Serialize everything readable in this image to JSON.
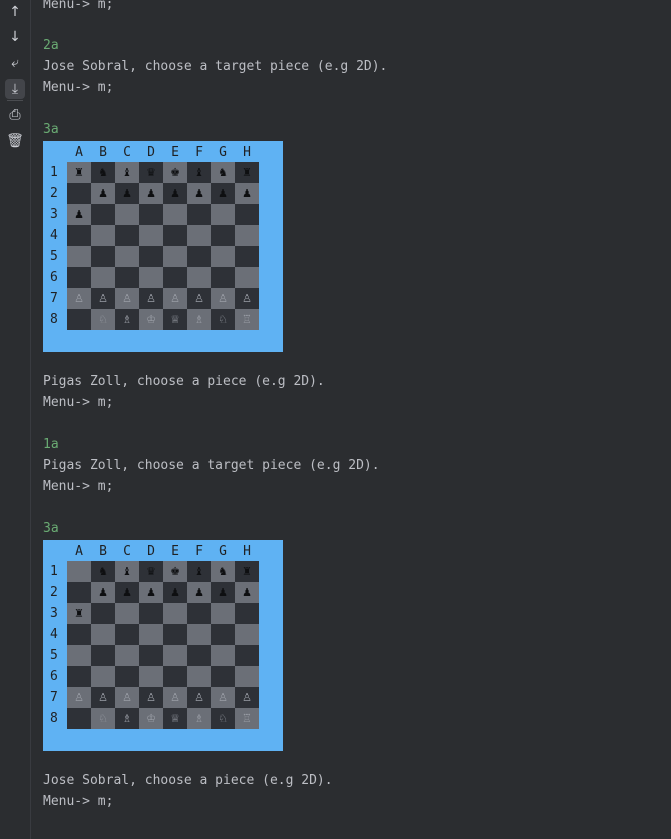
{
  "gutter": {
    "buttons": [
      {
        "name": "up-arrow-icon",
        "glyph": "↑"
      },
      {
        "name": "down-arrow-icon",
        "glyph": "↓"
      },
      {
        "name": "soft-wrap-icon",
        "glyph": "⤶"
      },
      {
        "name": "scroll-to-end-icon",
        "glyph": "⤓"
      },
      {
        "name": "print-icon",
        "glyph": "⎙"
      },
      {
        "name": "trash-icon",
        "glyph": "🗑"
      }
    ]
  },
  "console": {
    "l0": "Menu-> m;",
    "l1": "2a",
    "l2": "Jose Sobral, choose a target piece (e.g 2D).",
    "l3": "Menu-> m;",
    "l4": "3a",
    "l5": "Pigas Zoll, choose a piece (e.g 2D).",
    "l6": "Menu-> m;",
    "l7": "1a",
    "l8": "Pigas Zoll, choose a target piece (e.g 2D).",
    "l9": "Menu-> m;",
    "l10": "3a",
    "l11": "Jose Sobral, choose a piece (e.g 2D).",
    "l12": "Menu-> m;"
  },
  "boards": [
    {
      "columns": [
        "A",
        "B",
        "C",
        "D",
        "E",
        "F",
        "G",
        "H"
      ],
      "rows": [
        "1",
        "2",
        "3",
        "4",
        "5",
        "6",
        "7",
        "8"
      ],
      "pieces": [
        [
          "♜",
          "♞",
          "♝",
          "♛",
          "♚",
          "♝",
          "♞",
          "♜"
        ],
        [
          "",
          "♟",
          "♟",
          "♟",
          "♟",
          "♟",
          "♟",
          "♟"
        ],
        [
          "♟",
          "",
          "",
          "",
          "",
          "",
          "",
          ""
        ],
        [
          "",
          "",
          "",
          "",
          "",
          "",
          "",
          ""
        ],
        [
          "",
          "",
          "",
          "",
          "",
          "",
          "",
          ""
        ],
        [
          "",
          "",
          "",
          "",
          "",
          "",
          "",
          ""
        ],
        [
          "♙",
          "♙",
          "♙",
          "♙",
          "♙",
          "♙",
          "♙",
          "♙"
        ],
        [
          "",
          "♘",
          "♗",
          "♔",
          "♕",
          "♗",
          "♘",
          "♖"
        ]
      ]
    },
    {
      "columns": [
        "A",
        "B",
        "C",
        "D",
        "E",
        "F",
        "G",
        "H"
      ],
      "rows": [
        "1",
        "2",
        "3",
        "4",
        "5",
        "6",
        "7",
        "8"
      ],
      "pieces": [
        [
          "",
          "♞",
          "♝",
          "♛",
          "♚",
          "♝",
          "♞",
          "♜"
        ],
        [
          "",
          "♟",
          "♟",
          "♟",
          "♟",
          "♟",
          "♟",
          "♟"
        ],
        [
          "♜",
          "",
          "",
          "",
          "",
          "",
          "",
          ""
        ],
        [
          "",
          "",
          "",
          "",
          "",
          "",
          "",
          ""
        ],
        [
          "",
          "",
          "",
          "",
          "",
          "",
          "",
          ""
        ],
        [
          "",
          "",
          "",
          "",
          "",
          "",
          "",
          ""
        ],
        [
          "♙",
          "♙",
          "♙",
          "♙",
          "♙",
          "♙",
          "♙",
          "♙"
        ],
        [
          "",
          "♘",
          "♗",
          "♔",
          "♕",
          "♗",
          "♘",
          "♖"
        ]
      ]
    }
  ]
}
